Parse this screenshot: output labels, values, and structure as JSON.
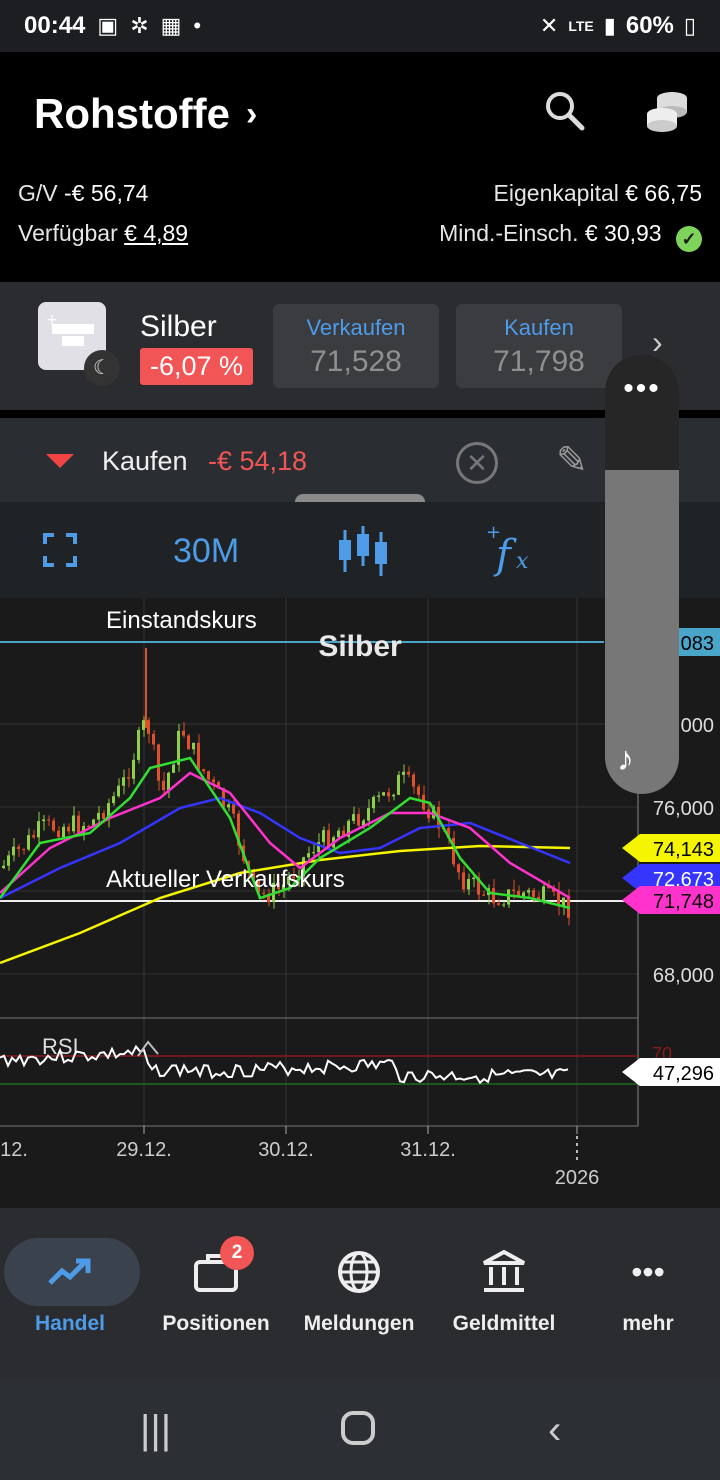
{
  "status_bar": {
    "time": "00:44",
    "network": "LTE",
    "battery": "60%"
  },
  "header": {
    "title": "Rohstoffe",
    "gv_label": "G/V",
    "gv_value": "-€ 56,74",
    "eigenkapital_label": "Eigenkapital",
    "eigenkapital_value": "€ 66,75",
    "verfuegbar_label": "Verfügbar",
    "verfuegbar_value": "€ 4,89",
    "mind_label": "Mind.-Einsch.",
    "mind_value": "€ 30,93"
  },
  "instrument": {
    "name": "Silber",
    "change_pct": "-6,07 %",
    "sell_label": "Verkaufen",
    "sell_price": "71,528",
    "buy_label": "Kaufen",
    "buy_price": "71,798"
  },
  "order": {
    "direction": "Kaufen",
    "pnl": "-€ 54,18"
  },
  "toolbar": {
    "interval": "30M"
  },
  "chart_data": {
    "type": "candlestick",
    "title": "Silber",
    "annotations": [
      "Einstandskurs",
      "Aktueller Verkaufskurs"
    ],
    "y_ticks": [
      "83",
      "000",
      "76,000",
      "68,000"
    ],
    "price_labels": [
      {
        "label": "083",
        "color": "#4aa6c8"
      },
      {
        "label": "74,143",
        "color": "#f5f500"
      },
      {
        "label": "72,673",
        "color": "#3535ff"
      },
      {
        "label": "71,748",
        "color": "#ff33cc"
      }
    ],
    "x_ticks": [
      "12.",
      "29.12.",
      "30.12.",
      "31.12.",
      "2026"
    ],
    "indicator": {
      "name": "RSI",
      "upper": "70",
      "value": "47,296"
    }
  },
  "bottom_nav": {
    "items": [
      {
        "label": "Handel"
      },
      {
        "label": "Positionen",
        "badge": "2"
      },
      {
        "label": "Meldungen"
      },
      {
        "label": "Geldmittel"
      },
      {
        "label": "mehr"
      }
    ]
  }
}
